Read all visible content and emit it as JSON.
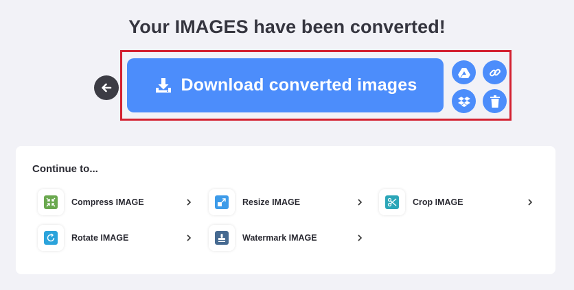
{
  "header": {
    "title": "Your IMAGES have been converted!"
  },
  "download": {
    "label": "Download converted images"
  },
  "icons": {
    "back": "arrow-left-icon",
    "download": "download-icon",
    "drive": "google-drive-icon",
    "link": "link-icon",
    "dropbox": "dropbox-icon",
    "delete": "trash-icon"
  },
  "continue": {
    "title": "Continue to...",
    "tools": [
      {
        "label": "Compress IMAGE",
        "icon": "compress-icon",
        "color": "#6aa84f"
      },
      {
        "label": "Resize IMAGE",
        "icon": "resize-icon",
        "color": "#3d9be9"
      },
      {
        "label": "Crop IMAGE",
        "icon": "crop-icon",
        "color": "#2ca6b8"
      },
      {
        "label": "Rotate IMAGE",
        "icon": "rotate-icon",
        "color": "#2ba3db"
      },
      {
        "label": "Watermark IMAGE",
        "icon": "watermark-icon",
        "color": "#466a91"
      }
    ]
  },
  "colors": {
    "accent": "#4c8dfb",
    "highlight_border": "#d32030",
    "back_button": "#3c3c44"
  }
}
